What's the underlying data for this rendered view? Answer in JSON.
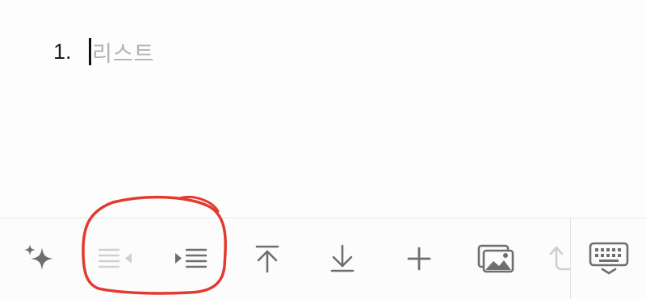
{
  "editor": {
    "list_number": "1.",
    "placeholder": "리스트"
  },
  "toolbar": {
    "tools": [
      {
        "name": "ai-sparkle",
        "icon": "sparkle-icon",
        "enabled": true
      },
      {
        "name": "outdent",
        "icon": "outdent-icon",
        "enabled": false
      },
      {
        "name": "indent",
        "icon": "indent-icon",
        "enabled": true
      },
      {
        "name": "move-to-top",
        "icon": "arrow-to-top-icon",
        "enabled": true
      },
      {
        "name": "move-to-bottom",
        "icon": "arrow-to-bottom-icon",
        "enabled": true
      },
      {
        "name": "insert",
        "icon": "plus-icon",
        "enabled": true
      },
      {
        "name": "insert-image",
        "icon": "image-icon",
        "enabled": true
      },
      {
        "name": "undo",
        "icon": "undo-arrow-icon",
        "enabled": false
      },
      {
        "name": "keyboard-toggle",
        "icon": "keyboard-hide-icon",
        "enabled": true
      }
    ]
  },
  "annotation": {
    "color": "#e23b2e"
  }
}
